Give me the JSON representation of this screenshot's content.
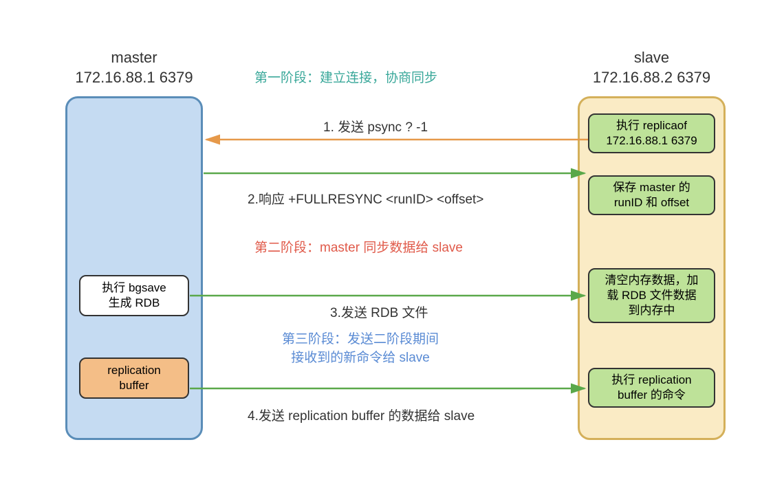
{
  "master": {
    "title_line1": "master",
    "title_line2": "172.16.88.1 6379",
    "bgsave_box": "执行 bgsave\n生成 RDB",
    "repl_buffer_box": "replication\nbuffer"
  },
  "slave": {
    "title_line1": "slave",
    "title_line2": "172.16.88.2 6379",
    "box1": "执行 replicaof\n172.16.88.1 6379",
    "box2": "保存 master 的\nrunID 和 offset",
    "box3": "清空内存数据，加\n载 RDB 文件数据\n到内存中",
    "box4": "执行 replication\nbuffer 的命令"
  },
  "stages": {
    "stage1": "第一阶段：建立连接，协商同步",
    "stage2": "第二阶段：master 同步数据给 slave",
    "stage3_line1": "第三阶段：发送二阶段期间",
    "stage3_line2": "接收到的新命令给 slave"
  },
  "steps": {
    "s1": "1. 发送 psync ? -1",
    "s2": "2.响应 +FULLRESYNC <runID> <offset>",
    "s3": "3.发送 RDB 文件",
    "s4": "4.发送 replication buffer 的数据给 slave"
  }
}
